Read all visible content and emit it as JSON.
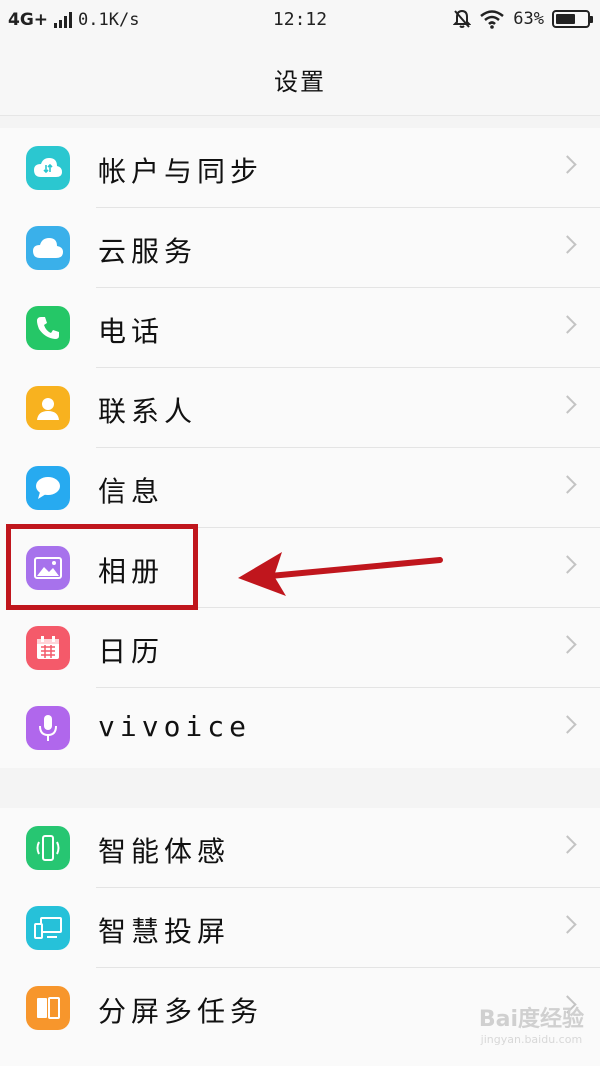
{
  "status_bar": {
    "network": "4G+",
    "speed": "0.1K/s",
    "time": "12:12",
    "battery": "63%",
    "battery_level": 0.63
  },
  "header": {
    "title": "设置"
  },
  "groups": [
    {
      "items": [
        {
          "label": "帐户与同步",
          "icon": "cloud-sync-icon",
          "color": "#2bc7d0"
        },
        {
          "label": "云服务",
          "icon": "cloud-icon",
          "color": "#3ab0ea"
        },
        {
          "label": "电话",
          "icon": "phone-icon",
          "color": "#25c767"
        },
        {
          "label": "联系人",
          "icon": "contact-icon",
          "color": "#f8b21f"
        },
        {
          "label": "信息",
          "icon": "message-icon",
          "color": "#27aaf0"
        },
        {
          "label": "相册",
          "icon": "photo-icon",
          "color": "#a772ec"
        },
        {
          "label": "日历",
          "icon": "calendar-icon",
          "color": "#f45a6a"
        },
        {
          "label": "vivoice",
          "icon": "microphone-icon",
          "color": "#b067ec"
        }
      ]
    },
    {
      "items": [
        {
          "label": "智能体感",
          "icon": "smart-motion-icon",
          "color": "#27c672"
        },
        {
          "label": "智慧投屏",
          "icon": "screen-cast-icon",
          "color": "#26c1d9"
        },
        {
          "label": "分屏多任务",
          "icon": "split-screen-icon",
          "color": "#f7962c"
        }
      ]
    }
  ],
  "annotation": {
    "highlight_color": "#c0161d"
  },
  "watermark": {
    "text": "Bai度经验",
    "sub": "jingyan.baidu.com"
  }
}
